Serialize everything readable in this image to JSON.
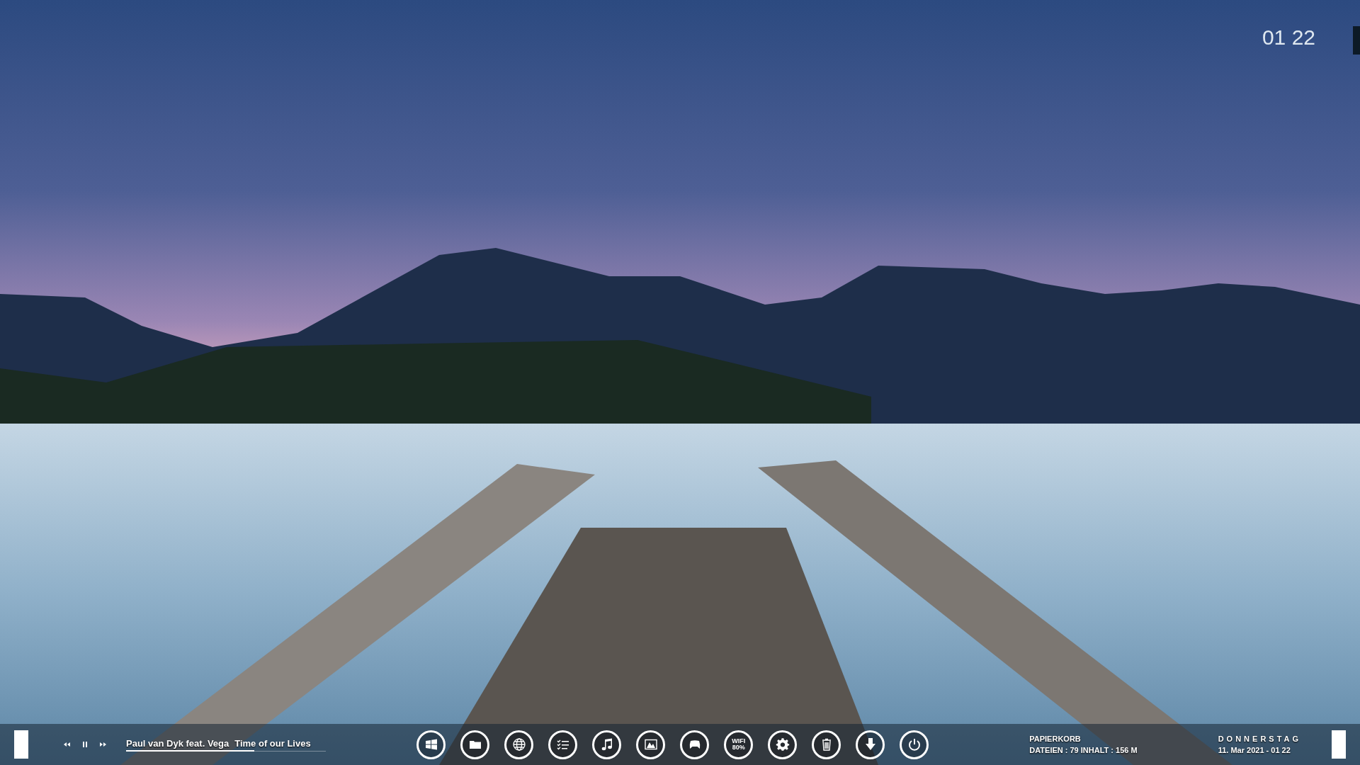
{
  "clock": {
    "time": "01 22"
  },
  "taskbar": {
    "media_controls": [
      {
        "kind": "previous"
      },
      {
        "kind": "pause"
      },
      {
        "kind": "next"
      }
    ],
    "track": {
      "artist": "Paul van Dyk feat. Vega",
      "title": "Time of our Lives",
      "level": 0.64
    },
    "launchers": [
      {
        "kind": "windows"
      },
      {
        "kind": "folder"
      },
      {
        "kind": "globe"
      },
      {
        "kind": "checklist"
      },
      {
        "kind": "music"
      },
      {
        "kind": "picture"
      },
      {
        "kind": "gamepad"
      },
      {
        "kind": "wifi",
        "label": "WIFI",
        "reading": "80%"
      },
      {
        "kind": "gear"
      },
      {
        "kind": "trash"
      },
      {
        "kind": "download"
      },
      {
        "kind": "power"
      }
    ],
    "recycle_bin": {
      "title": "PAPIERKORB",
      "info": "DATEIEN : 79  INHALT : 156 M"
    },
    "date": {
      "weekday": "DONNERSTAG",
      "date": "11. Mar 2021 - 01 22"
    }
  }
}
